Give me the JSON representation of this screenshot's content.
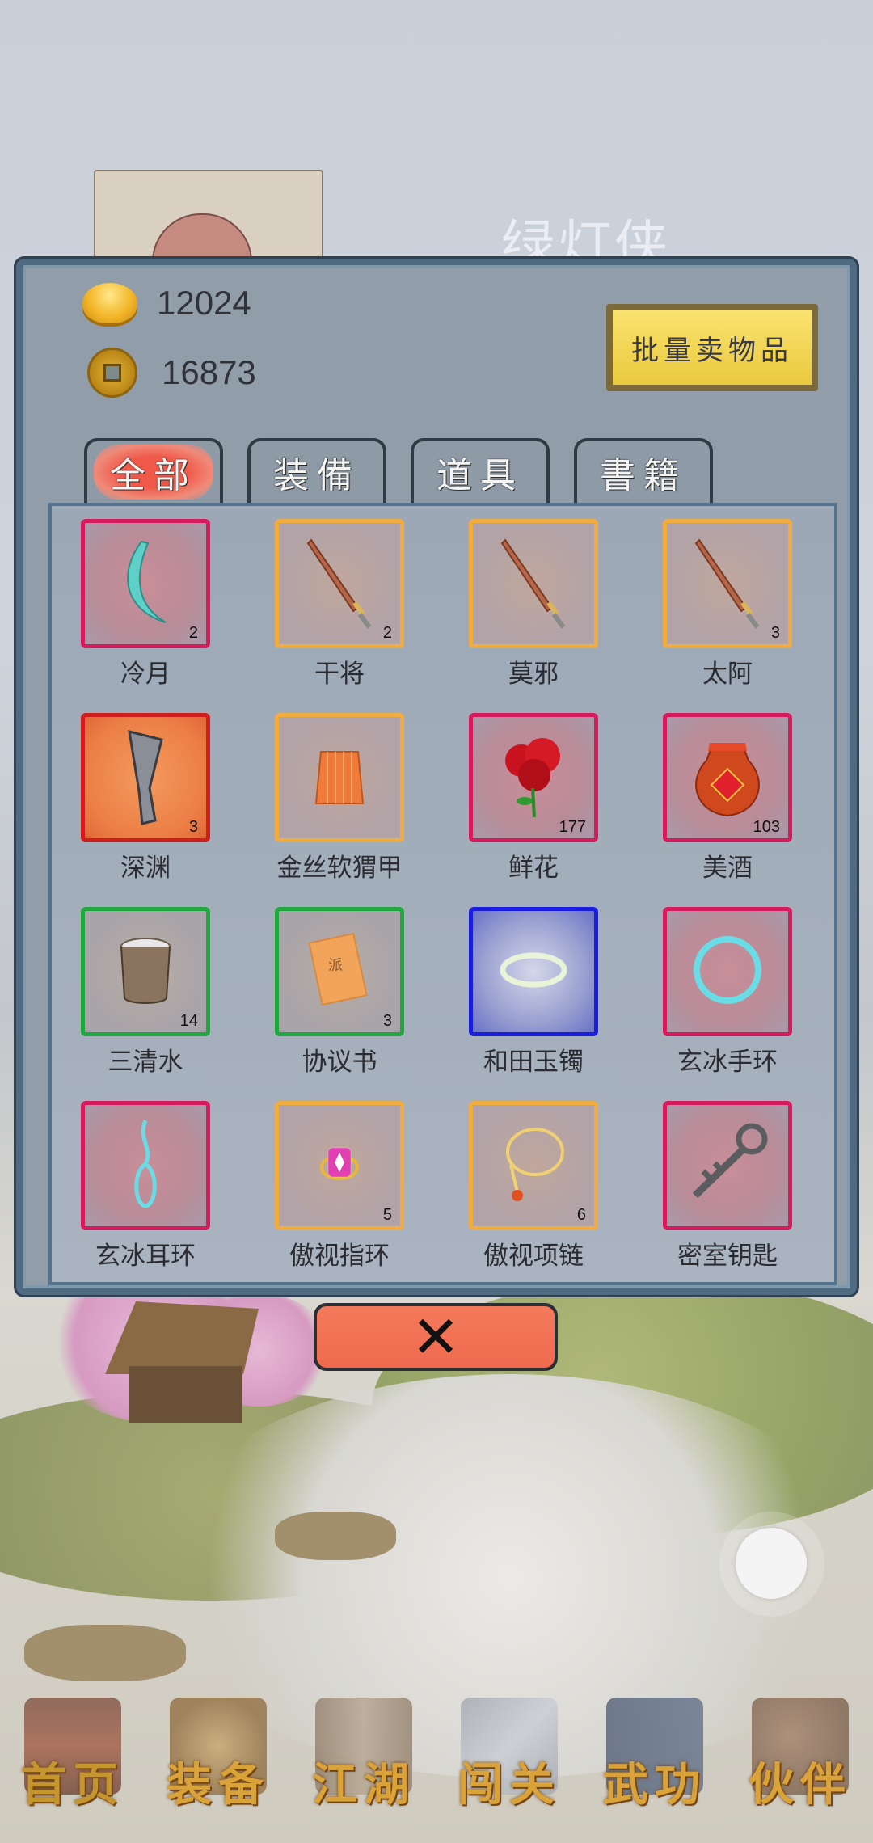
{
  "background": {
    "title": "绿灯侠"
  },
  "currency": {
    "gold": {
      "icon": "gold-ingot-icon",
      "value": "12024"
    },
    "coins": {
      "icon": "copper-coin-icon",
      "value": "16873"
    }
  },
  "sell_button": {
    "label": "批量卖物品"
  },
  "tabs": [
    {
      "label": "全部",
      "active": true
    },
    {
      "label": "装備",
      "active": false
    },
    {
      "label": "道具",
      "active": false
    },
    {
      "label": "書籍",
      "active": false
    }
  ],
  "items": [
    {
      "name": "冷月",
      "qty": "2",
      "quality": "red",
      "icon": "crescent-blade-icon"
    },
    {
      "name": "干将",
      "qty": "2",
      "quality": "orange",
      "icon": "sword-icon"
    },
    {
      "name": "莫邪",
      "qty": "",
      "quality": "orange",
      "icon": "sword-icon"
    },
    {
      "name": "太阿",
      "qty": "3",
      "quality": "orange",
      "icon": "sword-icon"
    },
    {
      "name": "深渊",
      "qty": "3",
      "quality": "fire",
      "icon": "dark-blade-icon"
    },
    {
      "name": "金丝软猬甲",
      "qty": "",
      "quality": "orange",
      "icon": "armor-vest-icon"
    },
    {
      "name": "鲜花",
      "qty": "177",
      "quality": "red",
      "icon": "rose-icon"
    },
    {
      "name": "美酒",
      "qty": "103",
      "quality": "red",
      "icon": "wine-jar-icon"
    },
    {
      "name": "三清水",
      "qty": "14",
      "quality": "green",
      "icon": "water-bucket-icon"
    },
    {
      "name": "协议书",
      "qty": "3",
      "quality": "green",
      "icon": "scroll-paper-icon"
    },
    {
      "name": "和田玉镯",
      "qty": "",
      "quality": "blue",
      "icon": "jade-bracelet-icon"
    },
    {
      "name": "玄冰手环",
      "qty": "",
      "quality": "red",
      "icon": "ice-bracelet-icon"
    },
    {
      "name": "玄冰耳环",
      "qty": "",
      "quality": "red",
      "icon": "earring-icon"
    },
    {
      "name": "傲视指环",
      "qty": "5",
      "quality": "orange",
      "icon": "ring-icon"
    },
    {
      "name": "傲视项链",
      "qty": "6",
      "quality": "orange",
      "icon": "necklace-icon"
    },
    {
      "name": "密室钥匙",
      "qty": "",
      "quality": "red",
      "icon": "key-icon"
    }
  ],
  "close_button": {
    "icon": "close-x-icon",
    "label": "✕"
  },
  "nav": [
    {
      "label": "首页",
      "icon": "home-building-icon",
      "active": true
    },
    {
      "label": "装备",
      "icon": "armor-icon",
      "active": false
    },
    {
      "label": "江湖",
      "icon": "scroll-map-icon",
      "active": false
    },
    {
      "label": "闯关",
      "icon": "crossed-swords-icon",
      "active": false
    },
    {
      "label": "武功",
      "icon": "martial-book-icon",
      "active": false
    },
    {
      "label": "伙伴",
      "icon": "partners-icon",
      "active": false
    }
  ],
  "colors": {
    "quality_red": "#d81a5c",
    "quality_orange": "#f2ac3d",
    "quality_green": "#1fa83e",
    "quality_blue": "#1a1ce0",
    "quality_fire": "#d01d1d",
    "nav_label": "#d9a33a"
  }
}
